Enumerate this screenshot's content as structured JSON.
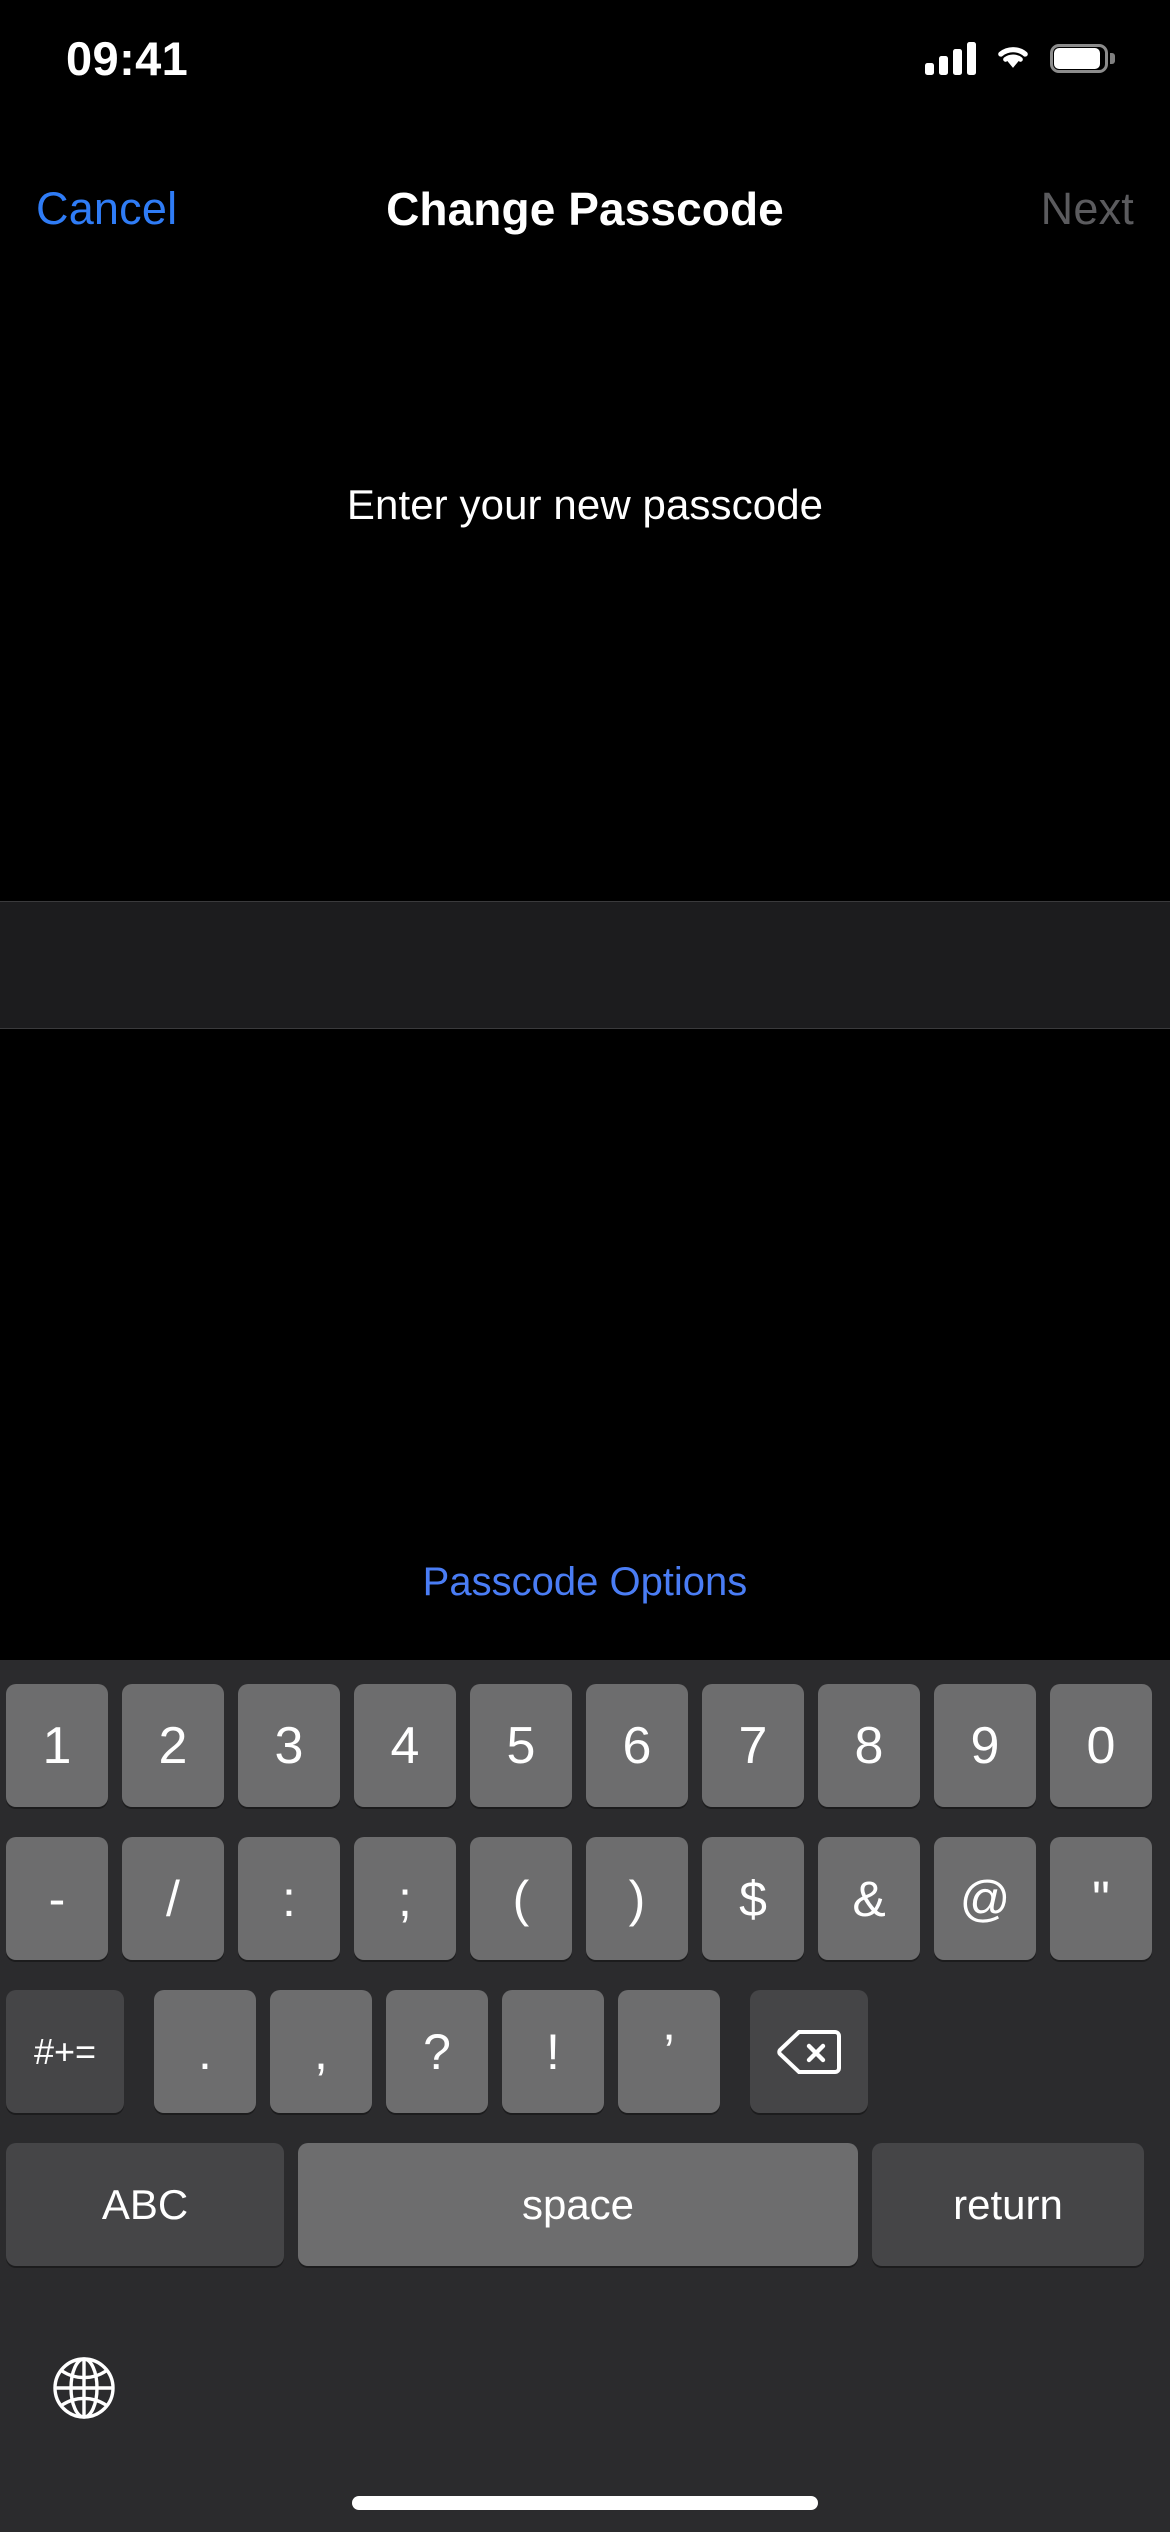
{
  "status_bar": {
    "time": "09:41",
    "signal_icon": "cellular-signal-icon",
    "wifi_icon": "wifi-icon",
    "battery_icon": "battery-icon",
    "signal_bars": 4,
    "battery_level": 100
  },
  "nav_bar": {
    "cancel_label": "Cancel",
    "title": "Change Passcode",
    "next_label": "Next",
    "next_enabled": false,
    "cancel_color": "#2f7cf6",
    "next_color": "#5b5b5e"
  },
  "content": {
    "prompt": "Enter your new passcode",
    "passcode_value": "",
    "passcode_placeholder": "",
    "passcode_options_label": "Passcode Options",
    "passcode_options_color": "#4a7df5"
  },
  "keyboard": {
    "layout": "numbers-and-symbols",
    "row1": [
      "1",
      "2",
      "3",
      "4",
      "5",
      "6",
      "7",
      "8",
      "9",
      "0"
    ],
    "row2": [
      "-",
      "/",
      ":",
      ";",
      "(",
      ")",
      "$",
      "&",
      "@",
      "\""
    ],
    "row3": {
      "shift_label": "#+=",
      "chars": [
        ".",
        ",",
        "?",
        "!",
        "’"
      ],
      "delete_icon": "backspace-delete-icon"
    },
    "row4": {
      "abc_label": "ABC",
      "space_label": "space",
      "return_label": "return"
    },
    "globe_icon": "globe-language-icon",
    "key_color": "#6d6d6e",
    "special_key_color": "#454547",
    "background_color": "#2b2b2d"
  },
  "home_indicator": "home-indicator"
}
